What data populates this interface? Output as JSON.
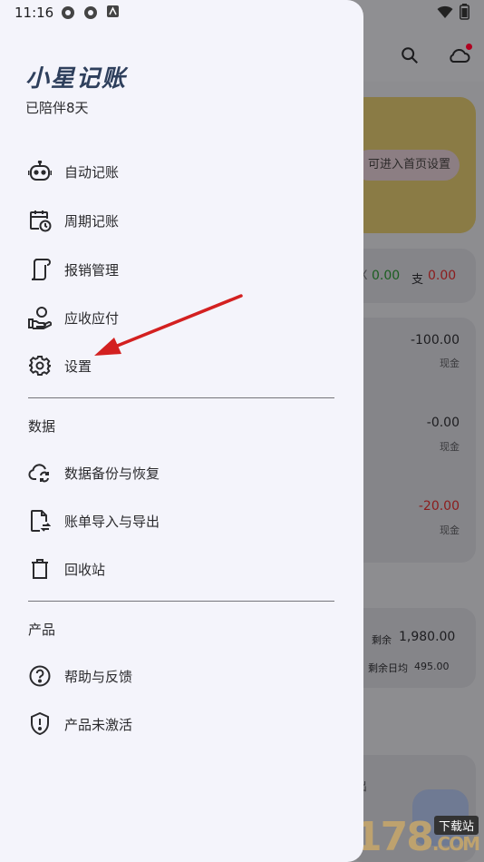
{
  "status_bar": {
    "time": "11:16"
  },
  "drawer": {
    "app_name": "小星记账",
    "days_text": "已陪伴8天",
    "menu": [
      {
        "label": "自动记账",
        "icon": "robot-icon"
      },
      {
        "label": "周期记账",
        "icon": "calendar-clock-icon"
      },
      {
        "label": "报销管理",
        "icon": "receipt-icon"
      },
      {
        "label": "应收应付",
        "icon": "hand-money-icon"
      },
      {
        "label": "设置",
        "icon": "gear-icon"
      }
    ],
    "data_section": {
      "title": "数据",
      "items": [
        {
          "label": "数据备份与恢复",
          "icon": "cloud-sync-icon"
        },
        {
          "label": "账单导入与导出",
          "icon": "file-transfer-icon"
        },
        {
          "label": "回收站",
          "icon": "trash-icon"
        }
      ]
    },
    "product_section": {
      "title": "产品",
      "items": [
        {
          "label": "帮助与反馈",
          "icon": "help-icon"
        },
        {
          "label": "产品未激活",
          "icon": "shield-alert-icon"
        }
      ]
    }
  },
  "background": {
    "banner_button": "可进入首页设置",
    "summary": {
      "income_prefix": "X",
      "income": "0.00",
      "expense_label": "支",
      "expense": "0.00"
    },
    "transactions": [
      {
        "amount": "-100.00",
        "account": "现金"
      },
      {
        "amount": "-0.00",
        "account": "现金"
      },
      {
        "amount": "-20.00",
        "account": "现金"
      }
    ],
    "budget": {
      "remain_label": "剩余",
      "remain": "1,980.00",
      "daily_label": "剩余日均",
      "daily": "495.00"
    },
    "partial_char": "出"
  },
  "watermark": {
    "number": "17178",
    "domain": ".COM",
    "tag": "下载站"
  }
}
